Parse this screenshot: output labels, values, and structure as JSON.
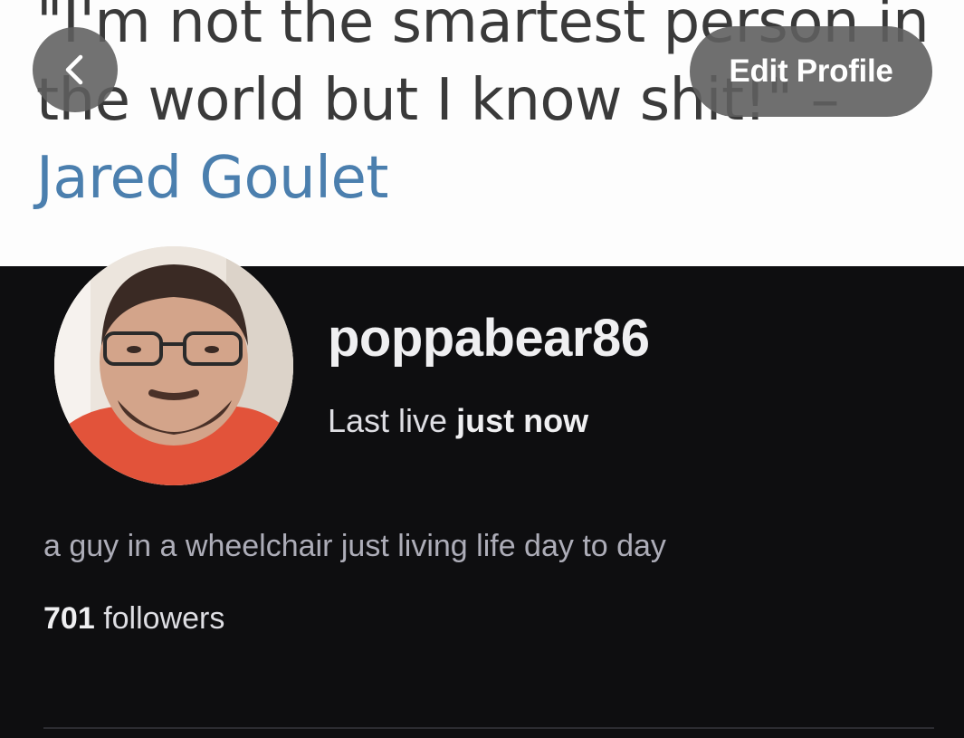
{
  "banner": {
    "quote_text": "\"I'm not the smartest person in the world but I know shit!\" –",
    "quote_author": "Jared Goulet"
  },
  "header": {
    "back_icon": "chevron-left-icon",
    "edit_profile_label": "Edit Profile"
  },
  "profile": {
    "avatar": "avatar-photo",
    "username": "poppabear86",
    "last_live_prefix": "Last live",
    "last_live_value": "just now",
    "bio": "a guy in a wheelchair just living life day to day",
    "followers_count": "701",
    "followers_label": "followers"
  },
  "colors": {
    "background": "#0e0e10",
    "banner_background": "#fdfdfd",
    "button_overlay": "#5f5f5f",
    "author_link": "#4b7fae",
    "text_primary": "#efeff1",
    "text_secondary": "#adadb8"
  }
}
